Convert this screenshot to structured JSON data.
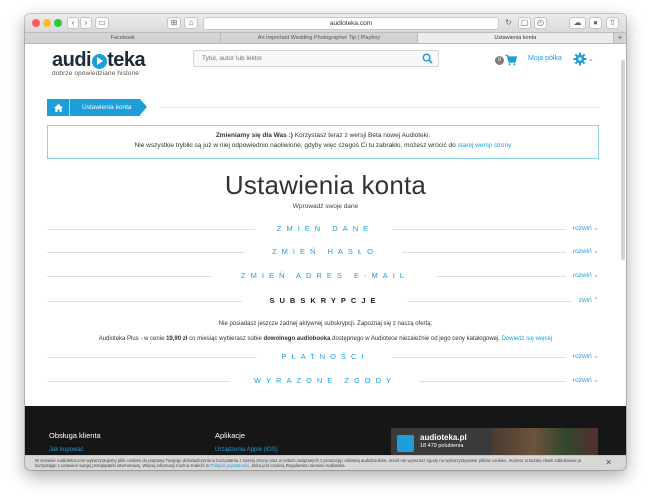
{
  "browser": {
    "address": "audioteka.com",
    "tabs": [
      {
        "label": "Facebook",
        "active": false
      },
      {
        "label": "An Important Wedding Photographer Tip | Playboy",
        "active": false
      },
      {
        "label": "Ustawienia konta",
        "active": true
      }
    ],
    "new_tab": "+"
  },
  "header": {
    "logo_left": "audi",
    "logo_right": "teka",
    "tagline": "dobrze opowiedziane historie",
    "search_placeholder": "Tytuł, autor lub lektor",
    "cart_count": "0",
    "my_shelf": "Moja półka"
  },
  "breadcrumb": {
    "current": "Ustawienia konta"
  },
  "notice": {
    "bold": "Zmieniamy się dla Was :)",
    "line1_rest": " Korzystasz teraz z wersji Beta nowej Audioteki.",
    "line2": "Nie wszystkie trybiki są już w niej odpowiednio naoliwione, gdyby więc czegoś Ci tu zabrakło, możesz wrócić do ",
    "link": "starej wersji strony"
  },
  "page": {
    "title": "Ustawienia konta",
    "subtitle": "Wprowadź swoje dane"
  },
  "sections": [
    {
      "title": "ZMIEŃ DANE",
      "toggle": "rozwiń ⌄",
      "expanded": false
    },
    {
      "title": "ZMIEŃ HASŁO",
      "toggle": "rozwiń ⌄",
      "expanded": false
    },
    {
      "title": "ZMIEŃ ADRES E-MAIL",
      "toggle": "rozwiń ⌄",
      "expanded": false
    },
    {
      "title": "SUBSKRYPCJE",
      "toggle": "zwiń ⌃",
      "expanded": true
    },
    {
      "title": "PŁATNOŚCI",
      "toggle": "rozwiń ⌄",
      "expanded": false
    },
    {
      "title": "WYRAŻONE ZGODY",
      "toggle": "rozwiń ⌄",
      "expanded": false
    }
  ],
  "subscriptions": {
    "line1": "Nie posiadasz jeszcze żadnej aktywnej subskrypcji. Zapoznaj się z naszą ofertą:",
    "line2_a": "Audioteka Plus - w cenie ",
    "price": "19,90 zł",
    "line2_b": " co miesiąc wybierasz sobie ",
    "bold2": "dowolnego audiobooka",
    "line2_c": " dostępnego w Audiotece niezależnie od jego ceny katalogowej. ",
    "link": "Dowiedz się więcej"
  },
  "footer": {
    "col1_heading": "Obsługa klienta",
    "col1_link": "Jak kupować",
    "col2_heading": "Aplikacje",
    "col2_link": "Urządzenia Apple (iOS)",
    "fb_name": "audioteka.pl",
    "fb_likes": "18 479 polubienia"
  },
  "cookie": {
    "text_a": "W serwisie Audioteka.com wykorzystujemy pliki cookies do poprawy Twojego doświadczenia w korzystaniu z naszej strony oraz w celach związanych z promocją i reklamą audiobooków. Jeżeli nie wyrażasz zgody na wykorzystywanie plików cookies, możesz w każdej chwili zablokować je korzystając z ustawień swojej przeglądarki internetowej. Więcej informacji można znaleźć w ",
    "policy_link": "Polityce prywatności",
    "text_b": ", która jest częścią Regulaminu serwisu Audioteka.",
    "close": "✕"
  },
  "colors": {
    "accent": "#1d9ed9",
    "footer_bg": "#161616"
  }
}
